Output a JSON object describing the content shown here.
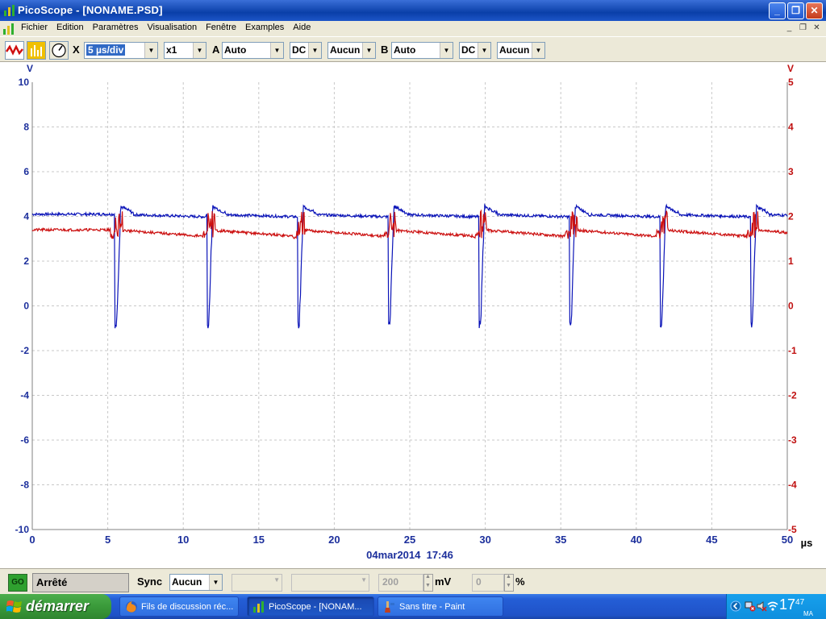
{
  "window": {
    "title": "PicoScope - [NONAME.PSD]",
    "buttons": {
      "minimize": "_",
      "maximize": "❐",
      "close": "✕"
    }
  },
  "menu": {
    "items": [
      "Fichier",
      "Edition",
      "Paramètres",
      "Visualisation",
      "Fenêtre",
      "Examples",
      "Aide"
    ]
  },
  "toolbar": {
    "x_label": "X",
    "timebase": "5 µs/div",
    "multiplier": "x1",
    "channel_a": {
      "label": "A",
      "range": "Auto",
      "coupling": "DC",
      "filter": "Aucun"
    },
    "channel_b": {
      "label": "B",
      "range": "Auto",
      "coupling": "DC",
      "filter": "Aucun"
    }
  },
  "chart_data": {
    "type": "line",
    "x_unit": "µs",
    "xlim": [
      0,
      50
    ],
    "x_ticks": [
      0,
      5,
      10,
      15,
      20,
      25,
      30,
      35,
      40,
      45,
      50
    ],
    "left_axis": {
      "unit": "V",
      "ylim": [
        -10,
        10
      ],
      "ticks": [
        10,
        8,
        6,
        4,
        2,
        0,
        -2,
        -4,
        -6,
        -8,
        -10
      ],
      "color": "#1c2f9c"
    },
    "right_axis": {
      "unit": "V",
      "ylim": [
        -5,
        5
      ],
      "ticks": [
        5,
        4,
        3,
        2,
        1,
        0,
        -1,
        -2,
        -3,
        -4,
        -5
      ],
      "color": "#c01010"
    },
    "grid": true,
    "timestamp": "04mar2014  17:46",
    "series": [
      {
        "axis": "left",
        "color": "#0b14b8",
        "baseline": 4.1,
        "pulse_times": [
          5.5,
          11.6,
          17.6,
          23.6,
          29.6,
          35.6,
          41.6,
          47.6
        ],
        "pulse_min": -1.0,
        "overshoot": 4.45
      },
      {
        "axis": "right",
        "color": "#cc1111",
        "baseline": 1.7,
        "pulse_times": [
          5.5,
          11.6,
          17.6,
          23.6,
          29.6,
          35.6,
          41.6,
          47.6
        ],
        "spike_max": 2.0,
        "dip": 1.55
      }
    ]
  },
  "statusbar": {
    "go_label": "GO",
    "state": "Arrêté",
    "sync_label": "Sync",
    "sync_value": "Aucun",
    "threshold_value": "200",
    "threshold_unit": "mV",
    "delay_value": "0",
    "delay_unit": "%"
  },
  "taskbar": {
    "start_label": "démarrer",
    "items": [
      {
        "label": "Fils de discussion réc...",
        "icon": "firefox-icon",
        "active": false
      },
      {
        "label": "PicoScope - [NONAM...",
        "icon": "picoscope-icon",
        "active": true
      },
      {
        "label": "Sans titre - Paint",
        "icon": "paint-icon",
        "active": false
      }
    ],
    "clock_hour": "17",
    "clock_min": "47",
    "clock_ampm": "MA"
  },
  "colors": {
    "titlebar": "#0a3fa8",
    "chrome": "#ece9d8",
    "channel_a": "#0b14b8",
    "channel_b": "#cc1111",
    "start_green": "#3a9a3a"
  }
}
